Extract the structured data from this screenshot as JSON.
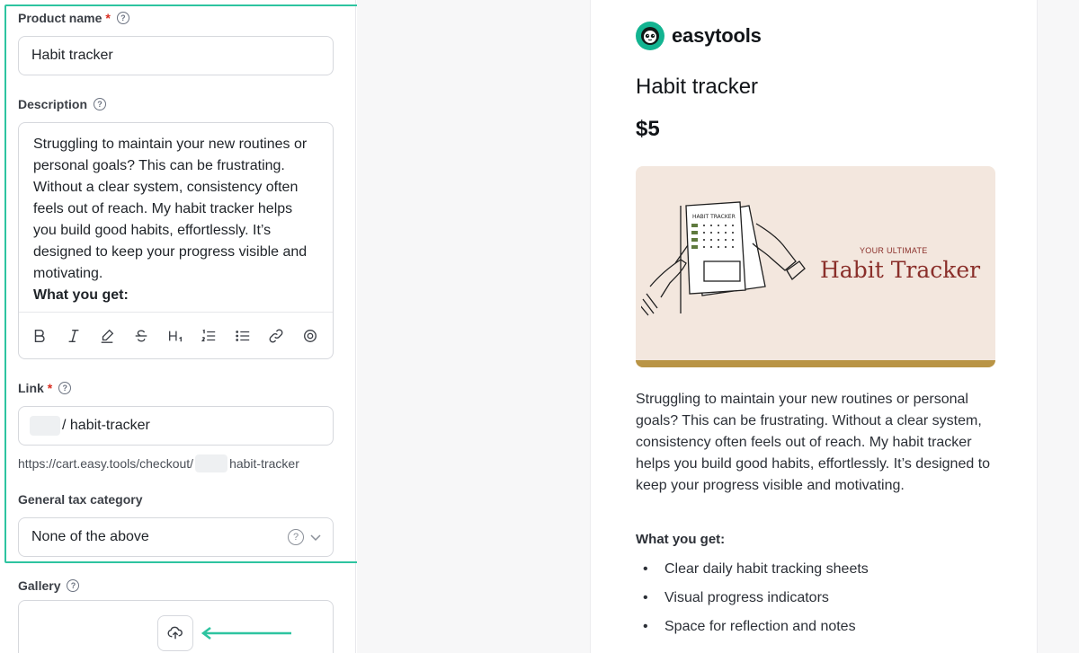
{
  "form": {
    "product_name": {
      "label": "Product name",
      "required": "*",
      "value": "Habit tracker"
    },
    "description": {
      "label": "Description",
      "text": "Struggling to maintain your new routines or personal goals? This can be frustrating. Without a clear system, consistency often feels out of reach. My habit tracker helps you build good habits, effortlessly. It’s designed to keep your progress visible and motivating.",
      "bold_line": "What you get:"
    },
    "toolbar": [
      "bold-icon",
      "italic-icon",
      "highlight-icon",
      "strikethrough-icon",
      "heading-icon",
      "ordered-list-icon",
      "bullet-list-icon",
      "link-icon",
      "embed-icon"
    ],
    "link": {
      "label": "Link",
      "required": "*",
      "value": "/ habit-tracker",
      "hint_prefix": "https://cart.easy.tools/checkout/",
      "hint_suffix": "habit-tracker"
    },
    "tax": {
      "label": "General tax category",
      "value": "None of the above"
    },
    "gallery": {
      "label": "Gallery"
    }
  },
  "preview": {
    "brand": "easytools",
    "title": "Habit tracker",
    "price": "$5",
    "banner": {
      "sub": "YOUR ULTIMATE",
      "title": "Habit Tracker",
      "sheet_label": "HABIT TRACKER"
    },
    "description": "Struggling to maintain your new routines or personal goals? This can be frustrating. Without a clear system, consistency often feels out of reach. My habit tracker helps you build good habits, effortlessly. It’s designed to keep your progress visible and motivating.",
    "get_heading": "What you get:",
    "items": [
      "Clear daily habit tracking sheets",
      "Visual progress indicators",
      "Space for reflection and notes"
    ]
  },
  "colors": {
    "accent": "#2ec4a0",
    "brand": "#13b491",
    "banner_bg": "#f3e7de",
    "banner_bar": "#b99445",
    "banner_text": "#8a2f2a"
  }
}
